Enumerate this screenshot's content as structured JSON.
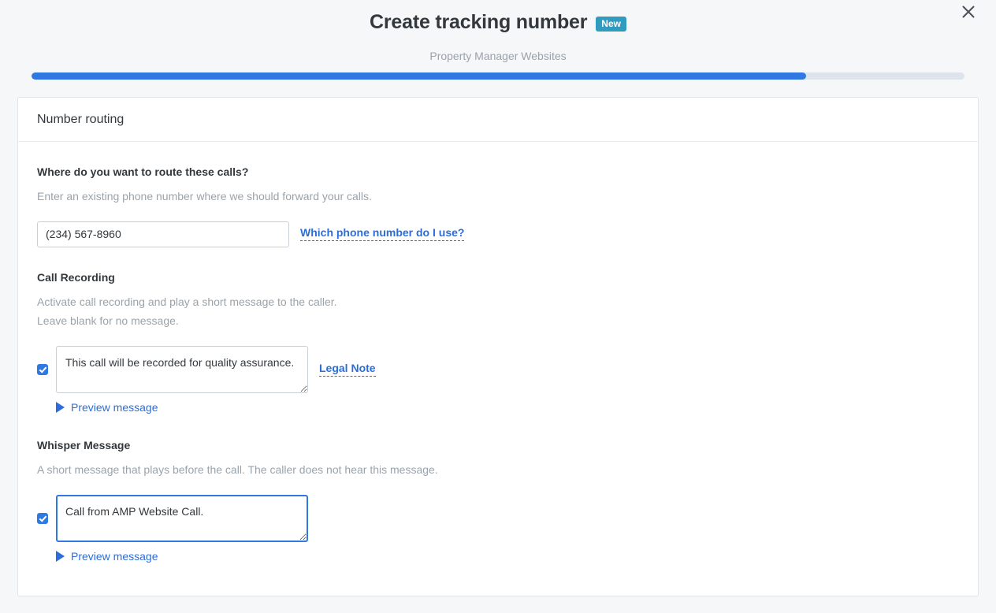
{
  "header": {
    "title": "Create tracking number",
    "badge": "New",
    "close_icon": "close-icon",
    "subtitle": "Property Manager Websites"
  },
  "progress": {
    "percent": 83,
    "fill_color": "#3079e3",
    "track_color": "#dde4ec"
  },
  "card": {
    "header_title": "Number routing"
  },
  "routing": {
    "label": "Where do you want to route these calls?",
    "description": "Enter an existing phone number where we should forward your calls.",
    "phone_value": "(234) 567-8960",
    "phone_placeholder": "(234) 567-8960",
    "help_link": "Which phone number do I use?"
  },
  "call_recording": {
    "label": "Call Recording",
    "description_line1": "Activate call recording and play a short message to the caller.",
    "description_line2": "Leave blank for no message.",
    "checkbox_checked": true,
    "message_value": "This call will be recorded for quality assurance.",
    "legal_link": "Legal Note",
    "preview_label": "Preview message",
    "play_icon": "play-icon"
  },
  "whisper_message": {
    "label": "Whisper Message",
    "description": "A short message that plays before the call. The caller does not hear this message.",
    "checkbox_checked": true,
    "message_value": "Call from AMP Website Call.",
    "preview_label": "Preview message",
    "play_icon": "play-icon"
  },
  "colors": {
    "accent_blue": "#3079e3",
    "link_blue": "#2a6ddb",
    "badge_teal": "#2f9cbf",
    "page_bg": "#f5f7f9",
    "muted_text": "#9aa3ab"
  }
}
